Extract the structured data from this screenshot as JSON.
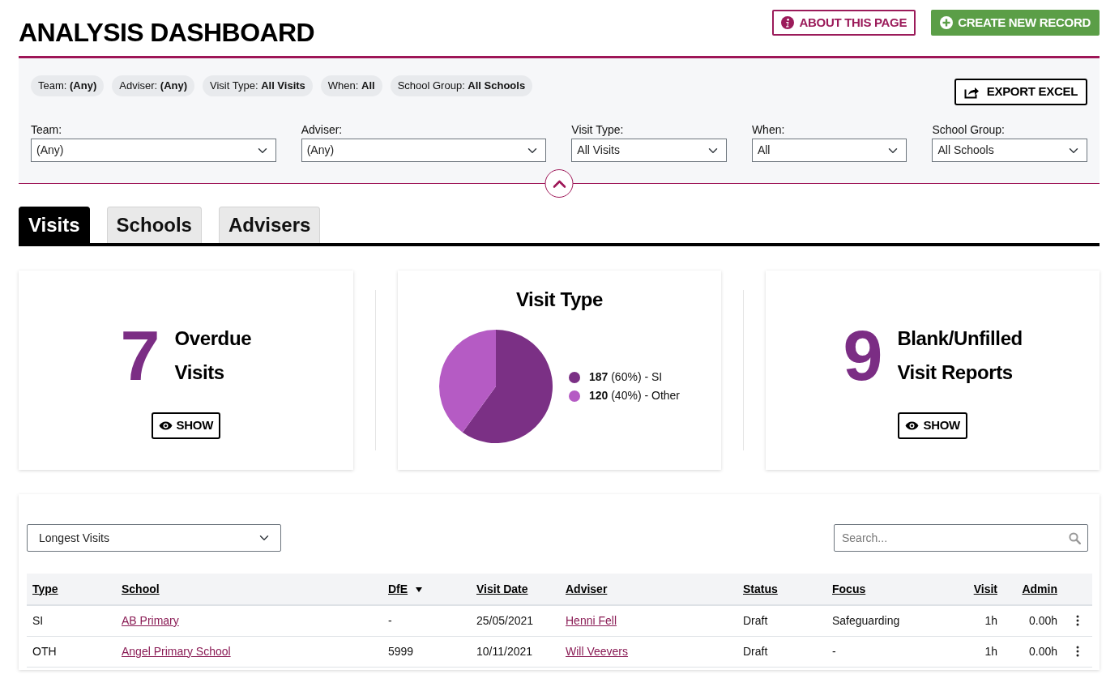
{
  "header": {
    "title": "ANALYSIS DASHBOARD",
    "buttons": [
      {
        "label": "ABOUT THIS PAGE",
        "kind": "info"
      },
      {
        "label": "CREATE NEW RECORD",
        "kind": "create"
      }
    ]
  },
  "filters": {
    "chips": [
      "Team: **(Any)**",
      "Adviser: **(Any)**",
      "Visit Type: **All Visits**",
      "When: **All**",
      "School Group: **All Schools**"
    ],
    "export_button": "EXPORT EXCEL",
    "expanded": true,
    "fields": [
      {
        "label": "Team:",
        "value": "(Any)"
      },
      {
        "label": "Adviser:",
        "value": "(Any)"
      },
      {
        "label": "Visit Type:",
        "value": "All Visits"
      },
      {
        "label": "When:",
        "value": "All"
      },
      {
        "label": "School Group:",
        "value": "All Schools"
      }
    ]
  },
  "tabs": [
    {
      "label": "Visits",
      "selected": true
    },
    {
      "label": "Schools",
      "selected": false
    },
    {
      "label": "Advisers",
      "selected": false
    }
  ],
  "cards": [
    {
      "kind": "stat",
      "count": "7",
      "label_lines": [
        "Overdue",
        "Visits"
      ],
      "button": "SHOW"
    },
    {
      "kind": "chart",
      "chart_data": {
        "type": "pie",
        "title": "Visit Type",
        "categories": [
          "SI",
          "Other"
        ],
        "values": [
          60,
          40
        ]
      },
      "legend": [
        {
          "text": "**187** (60%) -",
          "color": "#7b3085"
        },
        {
          "text": "**120** (40%) -",
          "color": "#b55bc4"
        }
      ]
    },
    {
      "kind": "stat",
      "count": "9",
      "label_lines": [
        "Blank/Unfilled",
        "Visit Reports"
      ],
      "button": "SHOW"
    }
  ],
  "table": {
    "view_select": "Longest Visits",
    "search": {
      "placeholder": "Search..."
    },
    "columns": [
      {
        "label": "Type",
        "kind": "text",
        "sorted": false
      },
      {
        "label": "School",
        "kind": "link",
        "sorted": false
      },
      {
        "label": "DfE",
        "kind": "text",
        "sorted": true
      },
      {
        "label": "Visit Date",
        "kind": "text",
        "sorted": false
      },
      {
        "label": "Adviser",
        "kind": "link",
        "sorted": false
      },
      {
        "label": "Status",
        "kind": "text",
        "sorted": false
      },
      {
        "label": "Focus",
        "kind": "text",
        "sorted": false
      },
      {
        "label": "Visit",
        "kind": "number",
        "sorted": false
      },
      {
        "label": "Admin",
        "kind": "number",
        "sorted": false
      }
    ],
    "rows": [
      [
        "SI",
        "AB Primary",
        "-",
        "25/05/2021",
        "Henni Fell",
        "Draft",
        "Safeguarding",
        "1h",
        "0.00h"
      ],
      [
        "OTH",
        "Angel Primary School",
        "5999",
        "10/11/2021",
        "Will Veevers",
        "Draft",
        "-",
        "1h",
        "0.00h"
      ]
    ]
  }
}
